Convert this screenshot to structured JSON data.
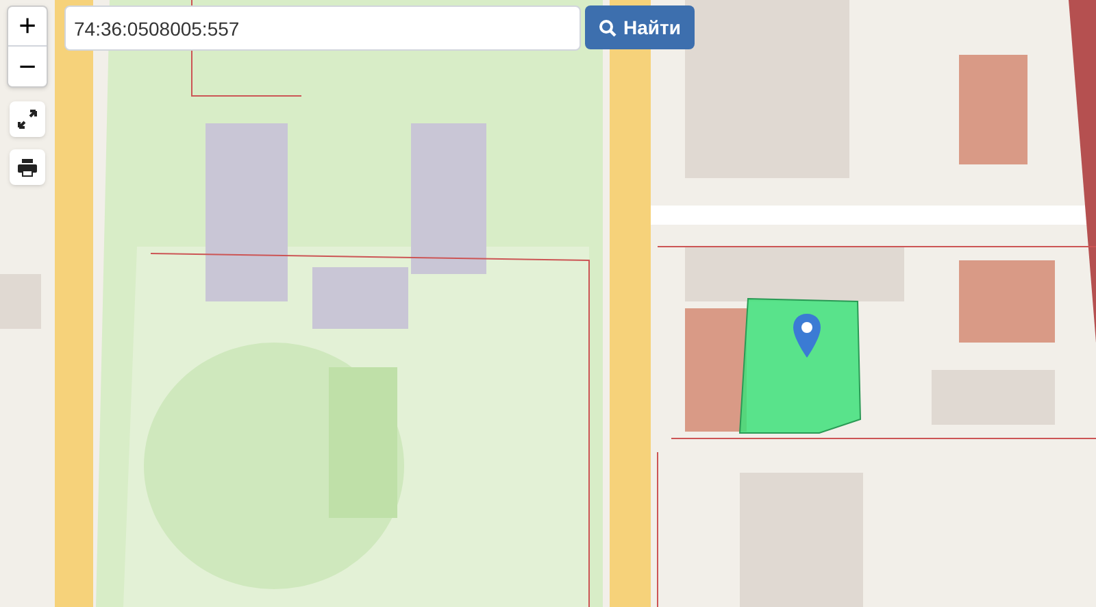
{
  "zoom_controls": {
    "zoom_in": "+",
    "zoom_out": "−"
  },
  "search": {
    "value": "74:36:0508005:557",
    "button": "Найти"
  }
}
